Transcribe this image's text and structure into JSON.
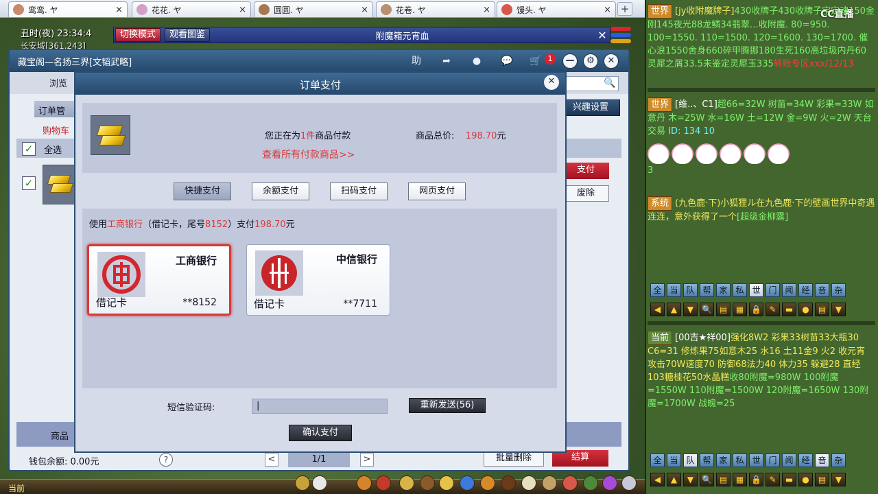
{
  "tabs": [
    {
      "title": "鸾鸾. ヤ",
      "icon": "character-avatar-icon",
      "icon_color": "#c78a6a",
      "active": true
    },
    {
      "title": "花花. ヤ",
      "icon": "character-avatar-icon",
      "icon_color": "#d4a0c8",
      "active": false
    },
    {
      "title": "圆圆. ヤ",
      "icon": "character-avatar-icon",
      "icon_color": "#a57852",
      "active": false
    },
    {
      "title": "花卷. ヤ",
      "icon": "character-avatar-icon",
      "icon_color": "#b89070",
      "active": false
    },
    {
      "title": "馒头. ヤ",
      "icon": "character-avatar-icon",
      "icon_color": "#d6584a",
      "active": false
    }
  ],
  "tab_close": "×",
  "new_tab": "+",
  "game": {
    "time": "丑时(夜)   23:34:4",
    "location": "长安城[361,243]",
    "mode_button": "切换模式",
    "view_button": "观看图鉴",
    "banner_title": "附魔箱元宵血",
    "banner_close": "✕",
    "bottom_current": "当前"
  },
  "shop": {
    "title": "藏宝阁—名扬三界[文韬武略]",
    "header_help": "助",
    "browse_tab": "浏览",
    "order_tab": "订单管",
    "interest_button": "兴趣设置",
    "cart_tab": "购物车",
    "select_all": "全选",
    "select_check": "✓",
    "row_pay": "支付",
    "row_delete": "废除",
    "product_header": "商品",
    "wallet": "钱包余额:  0.00元",
    "help": "?",
    "pager_prev": "<",
    "pager_value": "1/1",
    "pager_next": ">",
    "batch_delete": "批量删除",
    "settle": "结算",
    "cart_badge": "1"
  },
  "modal": {
    "title": "订单支付",
    "close": "✕",
    "summary_prefix": "您正在为",
    "summary_count": "1件",
    "summary_suffix": "商品付款",
    "total_label": "商品总价:",
    "total_value": "198.70",
    "total_unit": "元",
    "view_all": "查看所有付款商品>>",
    "pay_tabs": [
      "快捷支付",
      "余额支付",
      "扫码支付",
      "网页支付"
    ],
    "pay_desc_prefix": "使用",
    "pay_desc_bank": "工商银行",
    "pay_desc_mid": "（借记卡，尾号",
    "pay_desc_tail": "8152",
    "pay_desc_mid2": "）支付",
    "pay_desc_amount": "198.70",
    "pay_desc_unit": "元",
    "cards": [
      {
        "bank": "工商银行",
        "type": "借记卡",
        "number": "**8152",
        "selected": true,
        "logo": "icbc-logo-icon",
        "logo_color": "#d4262e"
      },
      {
        "bank": "中信银行",
        "type": "借记卡",
        "number": "**7711",
        "selected": false,
        "logo": "citic-logo-icon",
        "logo_color": "#c8252b"
      }
    ],
    "sms_label": "短信验证码:",
    "sms_value": "|",
    "resend": "重新发送(56)",
    "confirm": "确认支付"
  },
  "chat": {
    "logo": "CC直播",
    "msg1": {
      "channel": "世界",
      "name": "[jy收附魔牌子]",
      "text": "430收牌子430收牌子宝定魂150金刚145夜光88龙鳞34翡翠…收附魔. 80=950. 100=1550. 110=1500. 120=1600. 130=1700. 催心浪1550舍身660碎甲腾挪180生死160高垃圾内丹60灵犀之屑33.5未鉴定灵犀玉335",
      "tail": "转账专区xxx/12/13"
    },
    "msg2": {
      "channel": "世界",
      "name": "[维..、C1]",
      "text": "超66=32W  树苗=34W  彩果=33W  如意丹  木=25W 水=16W 土=12W 金=9W 火=2W 天台交易",
      "id": "ID: 134 10",
      "tail": "3"
    },
    "msg3": {
      "channel": "系统",
      "text": "(九色鹿·下)小狐狸ル在九色鹿·下的壁画世界中奇遇连连，意外获得了一个",
      "item": "[超级金柳露]"
    },
    "msg4": {
      "channel": "当前",
      "name": "[00吉★祥00]",
      "text": "强化8W2 彩果33树苗33大瓶30 C6=31 修炼果75如意木25 水16 土11金9 火2 收元宵 攻击70W速度70 防御68法力40 体力35 躲避28 直经103糖桂花50水晶糕",
      "tail": "收80附魔=980W 100附魔=1550W 110附魔=1500W 120附魔=1650W 130附魔=1700W 战魄=25"
    },
    "filters": [
      "全",
      "当",
      "队",
      "帮",
      "家",
      "私",
      "世",
      "门",
      "闻",
      "经",
      "音",
      "杂"
    ],
    "tools": [
      "◀",
      "▲",
      "▼",
      "🔍",
      "▤",
      "▦",
      "🔒",
      "✎",
      "▬",
      "●",
      "▤",
      "▼"
    ]
  }
}
